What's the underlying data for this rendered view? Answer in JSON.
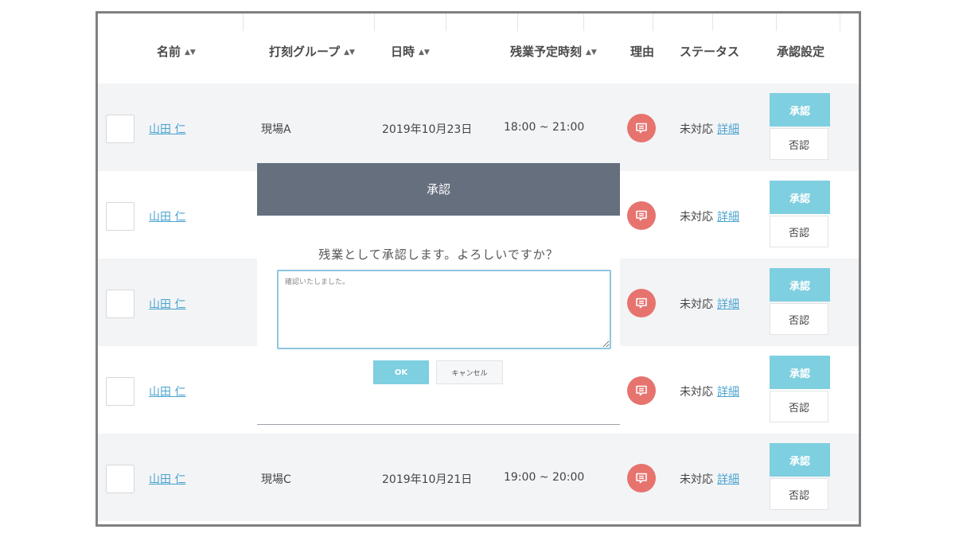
{
  "table": {
    "headers": {
      "name": "名前",
      "group": "打刻グループ",
      "datetime": "日時",
      "overtime": "残業予定時刻",
      "reason": "理由",
      "status": "ステータス",
      "approval": "承認設定"
    },
    "rows": [
      {
        "name": "山田 仁",
        "group": "現場A",
        "date": "2019年10月23日",
        "time": "18:00 ~ 21:00",
        "status": "未対応",
        "detail": "詳細",
        "approve": "承認",
        "reject": "否認"
      },
      {
        "name": "山田 仁",
        "group": "",
        "date": "",
        "time": "",
        "status": "未対応",
        "detail": "詳細",
        "approve": "承認",
        "reject": "否認"
      },
      {
        "name": "山田 仁",
        "group": "",
        "date": "",
        "time": "",
        "status": "未対応",
        "detail": "詳細",
        "approve": "承認",
        "reject": "否認"
      },
      {
        "name": "山田 仁",
        "group": "",
        "date": "",
        "time": "",
        "status": "未対応",
        "detail": "詳細",
        "approve": "承認",
        "reject": "否認"
      },
      {
        "name": "山田 仁",
        "group": "現場C",
        "date": "2019年10月21日",
        "time": "19:00 ~ 20:00",
        "status": "未対応",
        "detail": "詳細",
        "approve": "承認",
        "reject": "否認"
      }
    ]
  },
  "modal": {
    "title": "承認",
    "message": "残業として承認します。よろしいですか？",
    "comment": "確認いたしました。",
    "ok_label": "OK",
    "cancel_label": "キャンセル"
  },
  "colors": {
    "accent": "#7ecfe0",
    "reason_badge": "#e7736f",
    "modal_header": "#656f7e",
    "link": "#4aa3cf"
  },
  "icons": {
    "sort": "sort-updown-icon",
    "reason": "comment-icon"
  }
}
